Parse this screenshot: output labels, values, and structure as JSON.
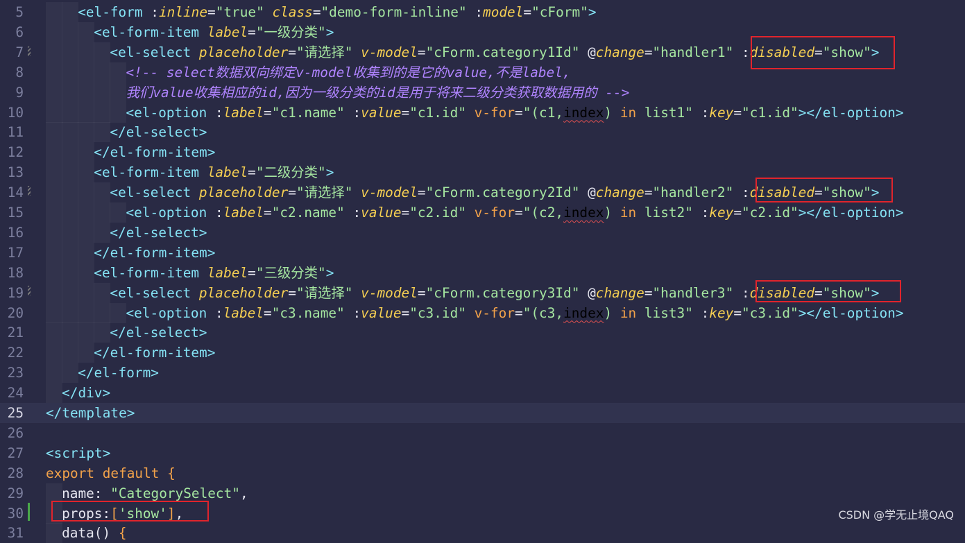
{
  "editor": {
    "lines": [
      {
        "num": "5",
        "indent": "    ",
        "segments": [
          [
            "t",
            "<el-form"
          ],
          [
            "o",
            " "
          ],
          [
            "ap",
            ":"
          ],
          [
            "a",
            "inline"
          ],
          [
            "o",
            "="
          ],
          [
            "s",
            "\"true\""
          ],
          [
            "o",
            " "
          ],
          [
            "a",
            "class"
          ],
          [
            "o",
            "="
          ],
          [
            "s",
            "\"demo-form-inline\""
          ],
          [
            "o",
            " "
          ],
          [
            "ap",
            ":"
          ],
          [
            "a",
            "model"
          ],
          [
            "o",
            "="
          ],
          [
            "s",
            "\"cForm\""
          ],
          [
            "t",
            ">"
          ]
        ]
      },
      {
        "num": "6",
        "indent": "      ",
        "segments": [
          [
            "t",
            "<el-form-item"
          ],
          [
            "o",
            " "
          ],
          [
            "a",
            "label"
          ],
          [
            "o",
            "="
          ],
          [
            "s",
            "\"一级分类\""
          ],
          [
            "t",
            ">"
          ]
        ]
      },
      {
        "num": "7",
        "indent": "        ",
        "segments": [
          [
            "t",
            "<el-select"
          ],
          [
            "o",
            " "
          ],
          [
            "a",
            "placeholder"
          ],
          [
            "o",
            "="
          ],
          [
            "s",
            "\"请选择\""
          ],
          [
            "o",
            " "
          ],
          [
            "a",
            "v-model"
          ],
          [
            "o",
            "="
          ],
          [
            "s",
            "\"cForm.category1Id\""
          ],
          [
            "o",
            " "
          ],
          [
            "ap",
            "@"
          ],
          [
            "a",
            "change"
          ],
          [
            "o",
            "="
          ],
          [
            "s",
            "\"handler1\""
          ],
          [
            "o",
            " "
          ],
          [
            "ap",
            ":"
          ],
          [
            "a",
            "disabled"
          ],
          [
            "o",
            "="
          ],
          [
            "s",
            "\"show\""
          ],
          [
            "t",
            ">"
          ]
        ]
      },
      {
        "num": "8",
        "indent": "          ",
        "segments": [
          [
            "c",
            "<!-- select数据双向绑定v-model收集到的是它的value,不是label,"
          ]
        ]
      },
      {
        "num": "9",
        "indent": "          ",
        "segments": [
          [
            "c",
            "我们value收集相应的id,因为一级分类的id是用于将来二级分类获取数据用的 -->"
          ]
        ]
      },
      {
        "num": "10",
        "indent": "          ",
        "segments": [
          [
            "t",
            "<el-option"
          ],
          [
            "o",
            " "
          ],
          [
            "ap",
            ":"
          ],
          [
            "a",
            "label"
          ],
          [
            "o",
            "="
          ],
          [
            "s",
            "\"c1.name\""
          ],
          [
            "o",
            " "
          ],
          [
            "ap",
            ":"
          ],
          [
            "a",
            "value"
          ],
          [
            "o",
            "="
          ],
          [
            "s",
            "\"c1.id\""
          ],
          [
            "o",
            " "
          ],
          [
            "k",
            "v-for"
          ],
          [
            "o",
            "="
          ],
          [
            "s",
            "\"(c1,"
          ],
          [
            "sq",
            "index"
          ],
          [
            "s",
            ")"
          ],
          [
            "o",
            " "
          ],
          [
            "k",
            "in"
          ],
          [
            "o",
            " "
          ],
          [
            "s",
            "list1\""
          ],
          [
            "o",
            " "
          ],
          [
            "ap",
            ":"
          ],
          [
            "a",
            "key"
          ],
          [
            "o",
            "="
          ],
          [
            "s",
            "\"c1.id\""
          ],
          [
            "t",
            "></el-option>"
          ]
        ]
      },
      {
        "num": "11",
        "indent": "        ",
        "segments": [
          [
            "t",
            "</el-select>"
          ]
        ]
      },
      {
        "num": "12",
        "indent": "      ",
        "segments": [
          [
            "t",
            "</el-form-item>"
          ]
        ]
      },
      {
        "num": "13",
        "indent": "      ",
        "segments": [
          [
            "t",
            "<el-form-item"
          ],
          [
            "o",
            " "
          ],
          [
            "a",
            "label"
          ],
          [
            "o",
            "="
          ],
          [
            "s",
            "\"二级分类\""
          ],
          [
            "t",
            ">"
          ]
        ]
      },
      {
        "num": "14",
        "indent": "        ",
        "segments": [
          [
            "t",
            "<el-select"
          ],
          [
            "o",
            " "
          ],
          [
            "a",
            "placeholder"
          ],
          [
            "o",
            "="
          ],
          [
            "s",
            "\"请选择\""
          ],
          [
            "o",
            " "
          ],
          [
            "a",
            "v-model"
          ],
          [
            "o",
            "="
          ],
          [
            "s",
            "\"cForm.category2Id\""
          ],
          [
            "o",
            " "
          ],
          [
            "ap",
            "@"
          ],
          [
            "a",
            "change"
          ],
          [
            "o",
            "="
          ],
          [
            "s",
            "\"handler2\""
          ],
          [
            "o",
            " "
          ],
          [
            "ap",
            ":"
          ],
          [
            "a",
            "disabled"
          ],
          [
            "o",
            "="
          ],
          [
            "s",
            "\"show\""
          ],
          [
            "t",
            ">"
          ]
        ]
      },
      {
        "num": "15",
        "indent": "          ",
        "segments": [
          [
            "t",
            "<el-option"
          ],
          [
            "o",
            " "
          ],
          [
            "ap",
            ":"
          ],
          [
            "a",
            "label"
          ],
          [
            "o",
            "="
          ],
          [
            "s",
            "\"c2.name\""
          ],
          [
            "o",
            " "
          ],
          [
            "ap",
            ":"
          ],
          [
            "a",
            "value"
          ],
          [
            "o",
            "="
          ],
          [
            "s",
            "\"c2.id\""
          ],
          [
            "o",
            " "
          ],
          [
            "k",
            "v-for"
          ],
          [
            "o",
            "="
          ],
          [
            "s",
            "\"(c2,"
          ],
          [
            "sq",
            "index"
          ],
          [
            "s",
            ")"
          ],
          [
            "o",
            " "
          ],
          [
            "k",
            "in"
          ],
          [
            "o",
            " "
          ],
          [
            "s",
            "list2\""
          ],
          [
            "o",
            " "
          ],
          [
            "ap",
            ":"
          ],
          [
            "a",
            "key"
          ],
          [
            "o",
            "="
          ],
          [
            "s",
            "\"c2.id\""
          ],
          [
            "t",
            "></el-option>"
          ]
        ]
      },
      {
        "num": "16",
        "indent": "        ",
        "segments": [
          [
            "t",
            "</el-select>"
          ]
        ]
      },
      {
        "num": "17",
        "indent": "      ",
        "segments": [
          [
            "t",
            "</el-form-item>"
          ]
        ]
      },
      {
        "num": "18",
        "indent": "      ",
        "segments": [
          [
            "t",
            "<el-form-item"
          ],
          [
            "o",
            " "
          ],
          [
            "a",
            "label"
          ],
          [
            "o",
            "="
          ],
          [
            "s",
            "\"三级分类\""
          ],
          [
            "t",
            ">"
          ]
        ]
      },
      {
        "num": "19",
        "indent": "        ",
        "segments": [
          [
            "t",
            "<el-select"
          ],
          [
            "o",
            " "
          ],
          [
            "a",
            "placeholder"
          ],
          [
            "o",
            "="
          ],
          [
            "s",
            "\"请选择\""
          ],
          [
            "o",
            " "
          ],
          [
            "a",
            "v-model"
          ],
          [
            "o",
            "="
          ],
          [
            "s",
            "\"cForm.category3Id\""
          ],
          [
            "o",
            " "
          ],
          [
            "ap",
            "@"
          ],
          [
            "a",
            "change"
          ],
          [
            "o",
            "="
          ],
          [
            "s",
            "\"handler3\""
          ],
          [
            "o",
            " "
          ],
          [
            "ap",
            ":"
          ],
          [
            "a",
            "disabled"
          ],
          [
            "o",
            "="
          ],
          [
            "s",
            "\"show\""
          ],
          [
            "t",
            ">"
          ]
        ]
      },
      {
        "num": "20",
        "indent": "          ",
        "segments": [
          [
            "t",
            "<el-option"
          ],
          [
            "o",
            " "
          ],
          [
            "ap",
            ":"
          ],
          [
            "a",
            "label"
          ],
          [
            "o",
            "="
          ],
          [
            "s",
            "\"c3.name\""
          ],
          [
            "o",
            " "
          ],
          [
            "ap",
            ":"
          ],
          [
            "a",
            "value"
          ],
          [
            "o",
            "="
          ],
          [
            "s",
            "\"c3.id\""
          ],
          [
            "o",
            " "
          ],
          [
            "k",
            "v-for"
          ],
          [
            "o",
            "="
          ],
          [
            "s",
            "\"(c3,"
          ],
          [
            "sq",
            "index"
          ],
          [
            "s",
            ")"
          ],
          [
            "o",
            " "
          ],
          [
            "k",
            "in"
          ],
          [
            "o",
            " "
          ],
          [
            "s",
            "list3\""
          ],
          [
            "o",
            " "
          ],
          [
            "ap",
            ":"
          ],
          [
            "a",
            "key"
          ],
          [
            "o",
            "="
          ],
          [
            "s",
            "\"c3.id\""
          ],
          [
            "t",
            "></el-option>"
          ]
        ]
      },
      {
        "num": "21",
        "indent": "        ",
        "segments": [
          [
            "t",
            "</el-select>"
          ]
        ]
      },
      {
        "num": "22",
        "indent": "      ",
        "segments": [
          [
            "t",
            "</el-form-item>"
          ]
        ]
      },
      {
        "num": "23",
        "indent": "    ",
        "segments": [
          [
            "t",
            "</el-form>"
          ]
        ]
      },
      {
        "num": "24",
        "indent": "  ",
        "segments": [
          [
            "t",
            "</div>"
          ]
        ]
      },
      {
        "num": "25",
        "indent": "",
        "segments": [
          [
            "t",
            "</template>"
          ]
        ],
        "current": true
      },
      {
        "num": "26",
        "indent": "",
        "segments": []
      },
      {
        "num": "27",
        "indent": "",
        "segments": [
          [
            "t",
            "<script>"
          ]
        ]
      },
      {
        "num": "28",
        "indent": "",
        "segments": [
          [
            "k",
            "export"
          ],
          [
            "o",
            " "
          ],
          [
            "k",
            "default"
          ],
          [
            "o",
            " "
          ],
          [
            "k",
            "{"
          ]
        ]
      },
      {
        "num": "29",
        "indent": "  ",
        "segments": [
          [
            "w",
            "name"
          ],
          [
            "o",
            ": "
          ],
          [
            "s",
            "\"CategorySelect\""
          ],
          [
            "o",
            ","
          ]
        ]
      },
      {
        "num": "30",
        "indent": "  ",
        "segments": [
          [
            "w",
            "props"
          ],
          [
            "o",
            ":"
          ],
          [
            "k",
            "["
          ],
          [
            "s",
            "'show'"
          ],
          [
            "k",
            "]"
          ],
          [
            "o",
            ","
          ]
        ]
      },
      {
        "num": "31",
        "indent": "  ",
        "segments": [
          [
            "w",
            "data"
          ],
          [
            "o",
            "() "
          ],
          [
            "k",
            "{"
          ]
        ]
      }
    ]
  },
  "watermark": "CSDN @学无止境QAQ"
}
